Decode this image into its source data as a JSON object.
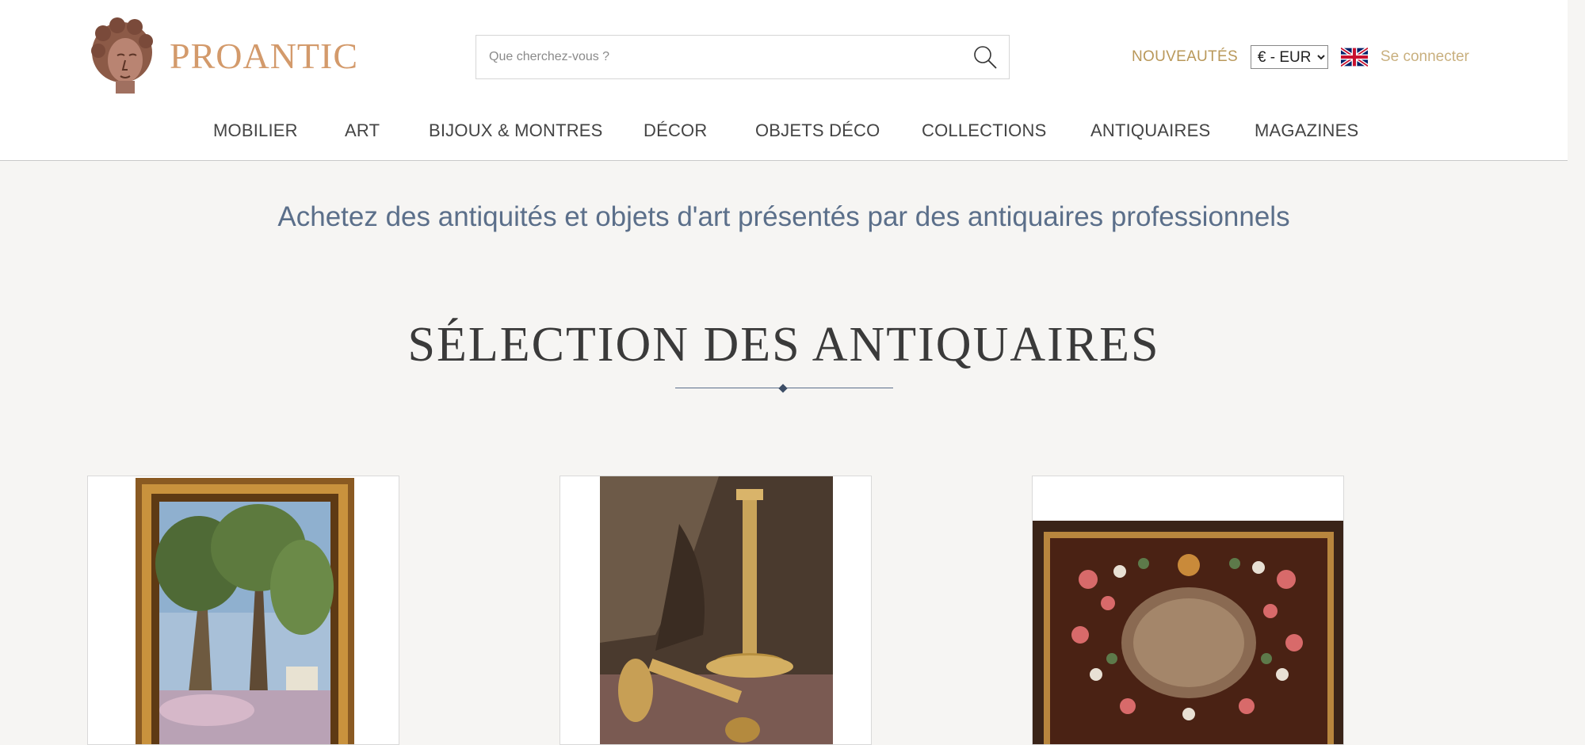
{
  "header": {
    "logo_text": "PROANTIC",
    "search": {
      "placeholder": "Que cherchez-vous ?",
      "value": ""
    },
    "nouveautes_label": "NOUVEAUTÉS",
    "currency": {
      "selected": "€ - EUR"
    },
    "language_flag": "uk-flag-icon",
    "login_label": "Se connecter"
  },
  "nav": {
    "items": [
      {
        "label": "MOBILIER"
      },
      {
        "label": "ART"
      },
      {
        "label": "BIJOUX & MONTRES"
      },
      {
        "label": "DÉCOR"
      },
      {
        "label": "OBJETS DÉCO"
      },
      {
        "label": "COLLECTIONS"
      },
      {
        "label": "ANTIQUAIRES"
      },
      {
        "label": "MAGAZINES"
      }
    ]
  },
  "main": {
    "tagline": "Achetez des antiquités et objets d'art présentés par des antiquaires professionnels",
    "section_title": "SÉLECTION DES ANTIQUAIRES"
  },
  "products": [
    {
      "image": "landscape-painting-image"
    },
    {
      "image": "gilt-candlestick-image"
    },
    {
      "image": "floral-tapestry-image"
    }
  ],
  "colors": {
    "brand": "#d39a6b",
    "gold_link": "#b9985a",
    "tagline": "#5b6f8a",
    "background": "#f6f5f3"
  }
}
